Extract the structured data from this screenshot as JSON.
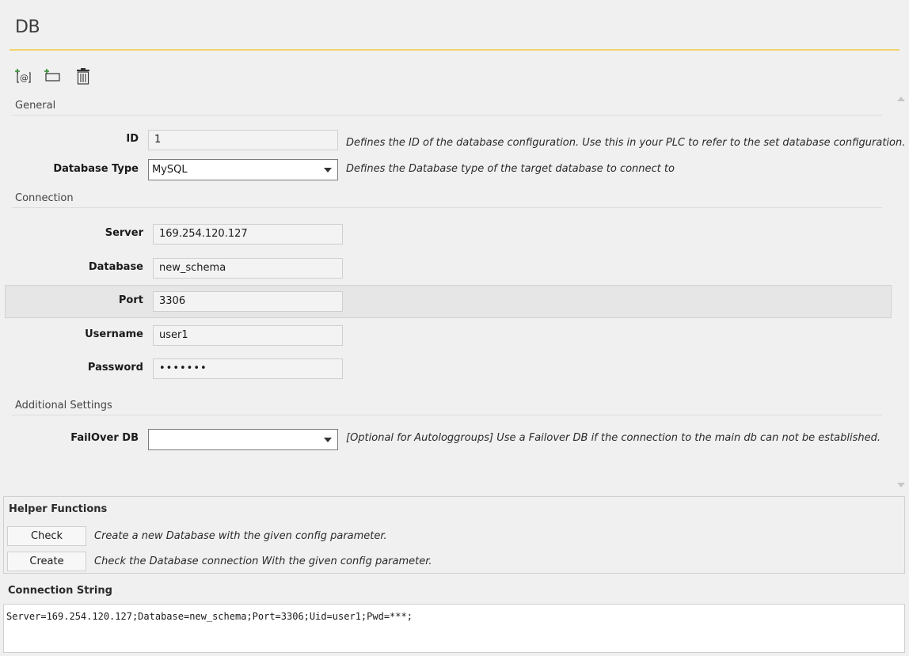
{
  "page": {
    "title": "DB",
    "accent_color": "#f3d36a"
  },
  "toolbar": {
    "icons": [
      "add-connection-icon",
      "add-folder-icon",
      "trash-icon"
    ]
  },
  "general": {
    "section_label": "General",
    "id": {
      "label": "ID",
      "value": "1",
      "description": "Defines the ID of the database configuration. Use this in your PLC to refer to the set database configuration."
    },
    "db_type": {
      "label": "Database Type",
      "value": "MySQL",
      "description": "Defines the Database type of the target database to connect to"
    }
  },
  "connection": {
    "section_label": "Connection",
    "server": {
      "label": "Server",
      "value": "169.254.120.127"
    },
    "database": {
      "label": "Database",
      "value": "new_schema"
    },
    "port": {
      "label": "Port",
      "value": "3306"
    },
    "username": {
      "label": "Username",
      "value": "user1"
    },
    "password": {
      "label": "Password",
      "value": "•••••••"
    }
  },
  "additional": {
    "section_label": "Additional Settings",
    "failover": {
      "label": "FailOver DB",
      "value": "",
      "description": "[Optional for Autologgroups] Use a Failover DB if the connection to the main db can not be established."
    }
  },
  "helper": {
    "title": "Helper Functions",
    "check_label": "Check",
    "check_description": "Create a new Database with the given config parameter.",
    "create_label": "Create",
    "create_description": "Check the Database connection With the given config parameter."
  },
  "connection_string": {
    "title": "Connection String",
    "value": "Server=169.254.120.127;Database=new_schema;Port=3306;Uid=user1;Pwd=***;"
  }
}
